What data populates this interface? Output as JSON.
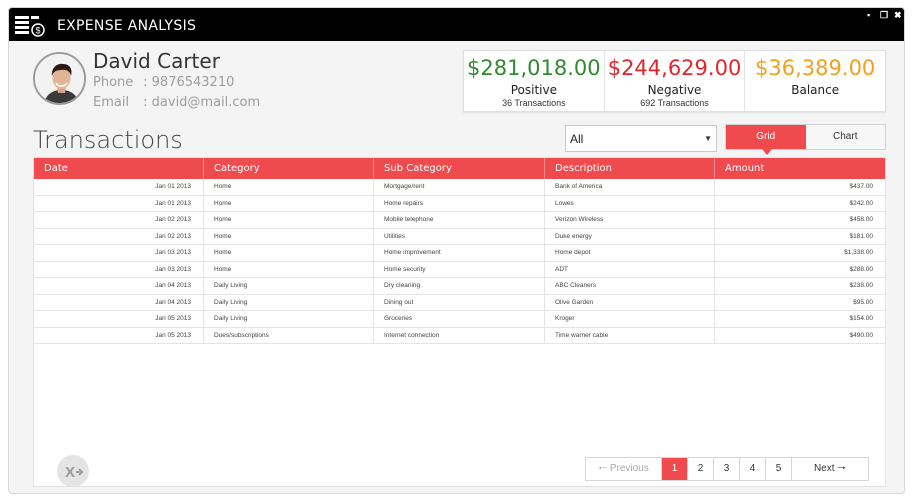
{
  "app": {
    "title": "EXPENSE ANALYSIS",
    "controls": [
      "▪",
      "❐",
      "✖"
    ]
  },
  "profile": {
    "name": "David Carter",
    "phone_label": "Phone",
    "phone": ": 9876543210",
    "email_label": "Email",
    "email": ": david@mail.com"
  },
  "summary": [
    {
      "amount": "$281,018.00",
      "label": "Positive",
      "sub": "36 Transactions",
      "color": "#2e8b2e"
    },
    {
      "amount": "$244,629.00",
      "label": "Negative",
      "sub": "692 Transactions",
      "color": "#e0262b"
    },
    {
      "amount": "$36,389.00",
      "label": "Balance",
      "sub": "",
      "color": "#f2a01f"
    }
  ],
  "section_title": "Transactions",
  "filter": {
    "selected": "All"
  },
  "view_toggle": {
    "grid": "Grid",
    "chart": "Chart",
    "active": "grid"
  },
  "grid": {
    "columns": [
      "Date",
      "Category",
      "Sub Category",
      "Description",
      "Amount"
    ],
    "rows": [
      [
        "Jan 01 2013",
        "Home",
        "Mortgage/rent",
        "Bank of America",
        "$437.00"
      ],
      [
        "Jan 01 2013",
        "Home",
        "Home repairs",
        "Lowes",
        "$242.00"
      ],
      [
        "Jan 02 2013",
        "Home",
        "Mobile telephone",
        "Verizon Wireless",
        "$458.00"
      ],
      [
        "Jan 02 2013",
        "Home",
        "Utilities",
        "Duke energy",
        "$181.00"
      ],
      [
        "Jan 03 2013",
        "Home",
        "Home improvement",
        "Home depot",
        "$1,338.00"
      ],
      [
        "Jan 03 2013",
        "Home",
        "Home security",
        "ADT",
        "$288.00"
      ],
      [
        "Jan 04 2013",
        "Daily Living",
        "Dry cleaning",
        "ABC Cleaners",
        "$238.00"
      ],
      [
        "Jan 04 2013",
        "Daily Living",
        "Dining out",
        "Olive Garden",
        "$95.00"
      ],
      [
        "Jan 05 2013",
        "Daily Living",
        "Groceries",
        "Kroger",
        "$154.00"
      ],
      [
        "Jan 05 2013",
        "Dues/subscriptions",
        "Internet connection",
        "Time warner cable",
        "$490.00"
      ]
    ]
  },
  "pager": {
    "previous": "Previous",
    "next": "Next",
    "pages": [
      "1",
      "2",
      "3",
      "4",
      "5"
    ],
    "current": "1"
  },
  "colors": {
    "accent": "#ef4b4f",
    "titlebar": "#000000"
  }
}
